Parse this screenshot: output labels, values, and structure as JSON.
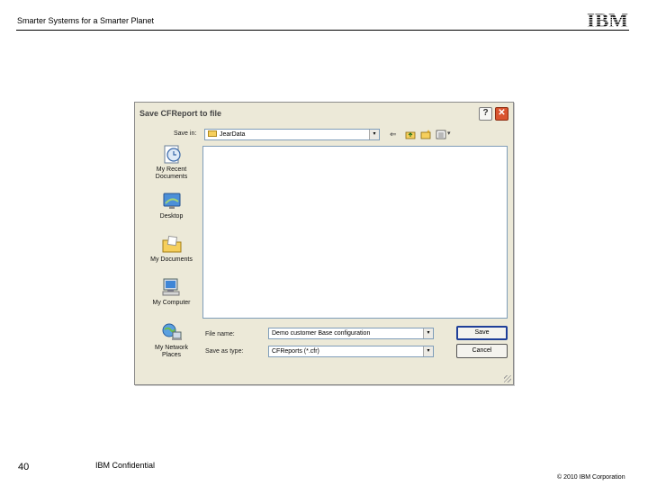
{
  "slide": {
    "header_text": "Smarter Systems for a Smarter Planet",
    "logo_text": "IBM",
    "slide_number": "40",
    "confidential": "IBM Confidential",
    "copyright": "© 2010 IBM Corporation"
  },
  "dialog": {
    "title": "Save CFReport to file",
    "help_glyph": "?",
    "close_glyph": "✕",
    "save_in_label": "Save in:",
    "save_in_value": "JearData",
    "combo_arrow_glyph": "▾",
    "toolbar_back_glyph": "⇐",
    "toolbar_more_glyph": "▾",
    "places": [
      {
        "label": "My Recent Documents",
        "icon": "recent-documents-icon"
      },
      {
        "label": "Desktop",
        "icon": "desktop-icon"
      },
      {
        "label": "My Documents",
        "icon": "my-documents-icon"
      },
      {
        "label": "My Computer",
        "icon": "my-computer-icon"
      },
      {
        "label": "My Network Places",
        "icon": "network-places-icon"
      }
    ],
    "file_name_label": "File name:",
    "file_name_value": "Demo customer Base configuration",
    "save_type_label": "Save as type:",
    "save_type_value": "CFReports (*.cfr)",
    "save_button": "Save",
    "cancel_button": "Cancel",
    "colors": {
      "title_close": "#d9542f",
      "field_border": "#7f9db9",
      "dialog_bg": "#ece9d8"
    }
  }
}
